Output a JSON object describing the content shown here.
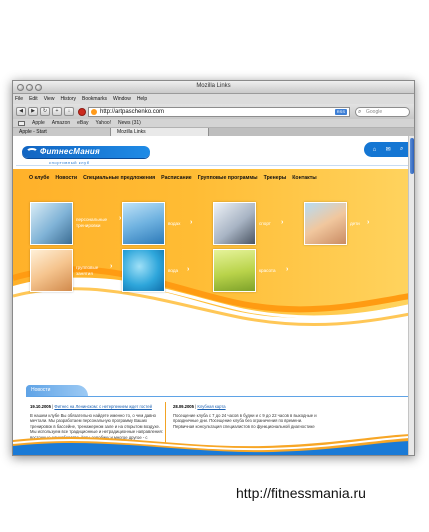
{
  "browser": {
    "window_title": "Mozilla Links",
    "menu": [
      "File",
      "Edit",
      "View",
      "History",
      "Bookmarks",
      "Window",
      "Help"
    ],
    "url": "http://artpaschenko.com",
    "rss": "RSS",
    "search_placeholder": "Google",
    "bookmarks": [
      "Apple",
      "Amazon",
      "eBay",
      "Yahoo!",
      "News (31)"
    ],
    "tabs": [
      "Apple - Start",
      "Mozilla Links"
    ]
  },
  "site": {
    "logo": "ФитнесМания",
    "tagline": "спортивный клуб",
    "nav": [
      "О клубе",
      "Новости",
      "Специальные предложения",
      "Расписание",
      "Групповые программы",
      "Тренеры",
      "Контакты"
    ],
    "tiles": [
      {
        "label_lines": [
          "персональные",
          "тренировки"
        ]
      },
      {
        "label_lines": [
          "водах"
        ]
      },
      {
        "label_lines": [
          "спорт"
        ]
      },
      {
        "label_lines": [
          "дети"
        ]
      },
      {
        "label_lines": [
          "групповые",
          "занятия"
        ]
      },
      {
        "label_lines": [
          "вода"
        ]
      },
      {
        "label_lines": [
          "красота"
        ]
      }
    ],
    "news_heading": "Новости",
    "news": [
      {
        "date": "19.10.2005",
        "title": "Фитнес на Ленинском: с нетерпением ждет гостей",
        "text": "В нашем клубе Вы обязательно найдете именно то, о чем давно мечтали. Мы разработаем персональную программу Ваших тренировок в бассейне, тренажерном зале и на открытом воздухе. Мы используем все традиционные и нетрадиционные направления: восточные единоборства, йогу, аэробику и многое другое - с единственной целью: Сделать Вас совершенным, а Вашу жизнь ярче."
      },
      {
        "date": "28.09.2005",
        "title": "Клубная карта",
        "text": "Посещение клуба с 7 до 24 часов в будни и с 9 до 22 часов в выходные и праздничные дни. Посещение клуба без ограничения по времени. Первичная консультация специалистов по функциональной диагностике"
      }
    ]
  },
  "caption": "http://fitnessmania.ru"
}
